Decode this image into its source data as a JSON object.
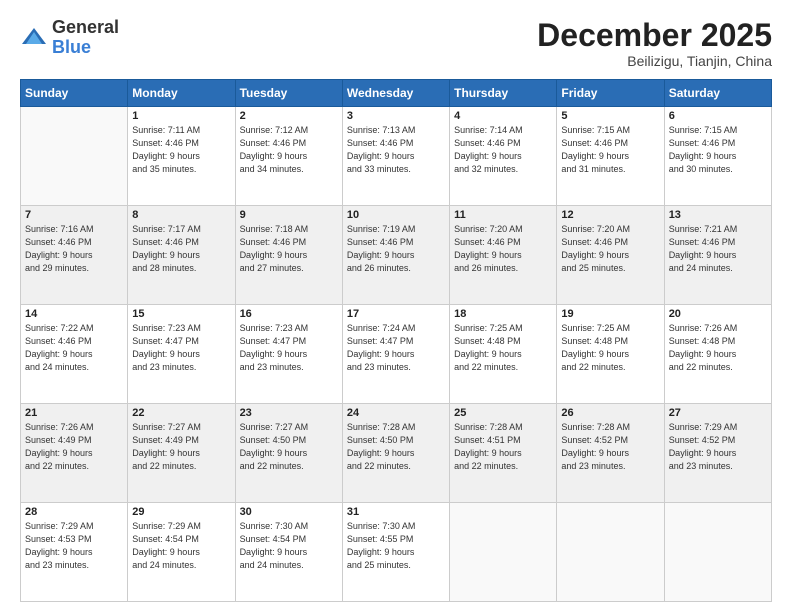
{
  "logo": {
    "general": "General",
    "blue": "Blue"
  },
  "header": {
    "month": "December 2025",
    "location": "Beilizigu, Tianjin, China"
  },
  "weekdays": [
    "Sunday",
    "Monday",
    "Tuesday",
    "Wednesday",
    "Thursday",
    "Friday",
    "Saturday"
  ],
  "weeks": [
    {
      "shade": false,
      "days": [
        {
          "num": "",
          "info": ""
        },
        {
          "num": "1",
          "info": "Sunrise: 7:11 AM\nSunset: 4:46 PM\nDaylight: 9 hours\nand 35 minutes."
        },
        {
          "num": "2",
          "info": "Sunrise: 7:12 AM\nSunset: 4:46 PM\nDaylight: 9 hours\nand 34 minutes."
        },
        {
          "num": "3",
          "info": "Sunrise: 7:13 AM\nSunset: 4:46 PM\nDaylight: 9 hours\nand 33 minutes."
        },
        {
          "num": "4",
          "info": "Sunrise: 7:14 AM\nSunset: 4:46 PM\nDaylight: 9 hours\nand 32 minutes."
        },
        {
          "num": "5",
          "info": "Sunrise: 7:15 AM\nSunset: 4:46 PM\nDaylight: 9 hours\nand 31 minutes."
        },
        {
          "num": "6",
          "info": "Sunrise: 7:15 AM\nSunset: 4:46 PM\nDaylight: 9 hours\nand 30 minutes."
        }
      ]
    },
    {
      "shade": true,
      "days": [
        {
          "num": "7",
          "info": "Sunrise: 7:16 AM\nSunset: 4:46 PM\nDaylight: 9 hours\nand 29 minutes."
        },
        {
          "num": "8",
          "info": "Sunrise: 7:17 AM\nSunset: 4:46 PM\nDaylight: 9 hours\nand 28 minutes."
        },
        {
          "num": "9",
          "info": "Sunrise: 7:18 AM\nSunset: 4:46 PM\nDaylight: 9 hours\nand 27 minutes."
        },
        {
          "num": "10",
          "info": "Sunrise: 7:19 AM\nSunset: 4:46 PM\nDaylight: 9 hours\nand 26 minutes."
        },
        {
          "num": "11",
          "info": "Sunrise: 7:20 AM\nSunset: 4:46 PM\nDaylight: 9 hours\nand 26 minutes."
        },
        {
          "num": "12",
          "info": "Sunrise: 7:20 AM\nSunset: 4:46 PM\nDaylight: 9 hours\nand 25 minutes."
        },
        {
          "num": "13",
          "info": "Sunrise: 7:21 AM\nSunset: 4:46 PM\nDaylight: 9 hours\nand 24 minutes."
        }
      ]
    },
    {
      "shade": false,
      "days": [
        {
          "num": "14",
          "info": "Sunrise: 7:22 AM\nSunset: 4:46 PM\nDaylight: 9 hours\nand 24 minutes."
        },
        {
          "num": "15",
          "info": "Sunrise: 7:23 AM\nSunset: 4:47 PM\nDaylight: 9 hours\nand 23 minutes."
        },
        {
          "num": "16",
          "info": "Sunrise: 7:23 AM\nSunset: 4:47 PM\nDaylight: 9 hours\nand 23 minutes."
        },
        {
          "num": "17",
          "info": "Sunrise: 7:24 AM\nSunset: 4:47 PM\nDaylight: 9 hours\nand 23 minutes."
        },
        {
          "num": "18",
          "info": "Sunrise: 7:25 AM\nSunset: 4:48 PM\nDaylight: 9 hours\nand 22 minutes."
        },
        {
          "num": "19",
          "info": "Sunrise: 7:25 AM\nSunset: 4:48 PM\nDaylight: 9 hours\nand 22 minutes."
        },
        {
          "num": "20",
          "info": "Sunrise: 7:26 AM\nSunset: 4:48 PM\nDaylight: 9 hours\nand 22 minutes."
        }
      ]
    },
    {
      "shade": true,
      "days": [
        {
          "num": "21",
          "info": "Sunrise: 7:26 AM\nSunset: 4:49 PM\nDaylight: 9 hours\nand 22 minutes."
        },
        {
          "num": "22",
          "info": "Sunrise: 7:27 AM\nSunset: 4:49 PM\nDaylight: 9 hours\nand 22 minutes."
        },
        {
          "num": "23",
          "info": "Sunrise: 7:27 AM\nSunset: 4:50 PM\nDaylight: 9 hours\nand 22 minutes."
        },
        {
          "num": "24",
          "info": "Sunrise: 7:28 AM\nSunset: 4:50 PM\nDaylight: 9 hours\nand 22 minutes."
        },
        {
          "num": "25",
          "info": "Sunrise: 7:28 AM\nSunset: 4:51 PM\nDaylight: 9 hours\nand 22 minutes."
        },
        {
          "num": "26",
          "info": "Sunrise: 7:28 AM\nSunset: 4:52 PM\nDaylight: 9 hours\nand 23 minutes."
        },
        {
          "num": "27",
          "info": "Sunrise: 7:29 AM\nSunset: 4:52 PM\nDaylight: 9 hours\nand 23 minutes."
        }
      ]
    },
    {
      "shade": false,
      "days": [
        {
          "num": "28",
          "info": "Sunrise: 7:29 AM\nSunset: 4:53 PM\nDaylight: 9 hours\nand 23 minutes."
        },
        {
          "num": "29",
          "info": "Sunrise: 7:29 AM\nSunset: 4:54 PM\nDaylight: 9 hours\nand 24 minutes."
        },
        {
          "num": "30",
          "info": "Sunrise: 7:30 AM\nSunset: 4:54 PM\nDaylight: 9 hours\nand 24 minutes."
        },
        {
          "num": "31",
          "info": "Sunrise: 7:30 AM\nSunset: 4:55 PM\nDaylight: 9 hours\nand 25 minutes."
        },
        {
          "num": "",
          "info": ""
        },
        {
          "num": "",
          "info": ""
        },
        {
          "num": "",
          "info": ""
        }
      ]
    }
  ]
}
